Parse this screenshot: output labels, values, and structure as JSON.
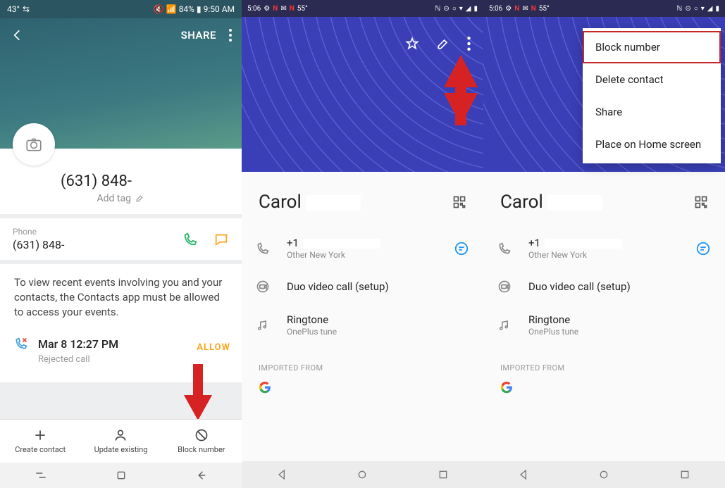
{
  "pane1": {
    "status": {
      "temp": "43°",
      "wifi_small": "⇆",
      "mute": "🔇",
      "sig": "📶",
      "batt": "84%",
      "time": "9:50 AM"
    },
    "back_icon": "back-icon",
    "share_label": "SHARE",
    "more_icon": "more-icon",
    "camera_icon": "camera-icon",
    "contact_number": "(631) 848-",
    "add_tag": "Add tag",
    "phone_label": "Phone",
    "phone_value": "(631) 848-",
    "call_icon": "phone-icon",
    "msg_icon": "message-icon",
    "events_prompt": "To view recent events involving you and your contacts, the Contacts app must be allowed to access your events.",
    "allow": "ALLOW",
    "evt_time": "Mar 8 12:27 PM",
    "evt_sub": "Rejected call",
    "bottom": {
      "create": "Create contact",
      "update": "Update existing",
      "block": "Block number"
    }
  },
  "pane2": {
    "status_time": "5:06",
    "status_temp": "55°",
    "name": "Carol",
    "phone_prefix": "+1",
    "phone_sub": "Other New York",
    "duo_label": "Duo video call (setup)",
    "ringtone_label": "Ringtone",
    "ringtone_val": "OnePlus tune",
    "imported": "IMPORTED FROM"
  },
  "pane3": {
    "status_time": "5:06",
    "status_temp": "55°",
    "name": "Carol",
    "phone_prefix": "+1",
    "phone_sub": "Other New York",
    "duo_label": "Duo video call (setup)",
    "ringtone_label": "Ringtone",
    "ringtone_val": "OnePlus tune",
    "imported": "IMPORTED FROM",
    "menu": {
      "block": "Block number",
      "delete": "Delete contact",
      "share": "Share",
      "home": "Place on Home screen"
    }
  }
}
